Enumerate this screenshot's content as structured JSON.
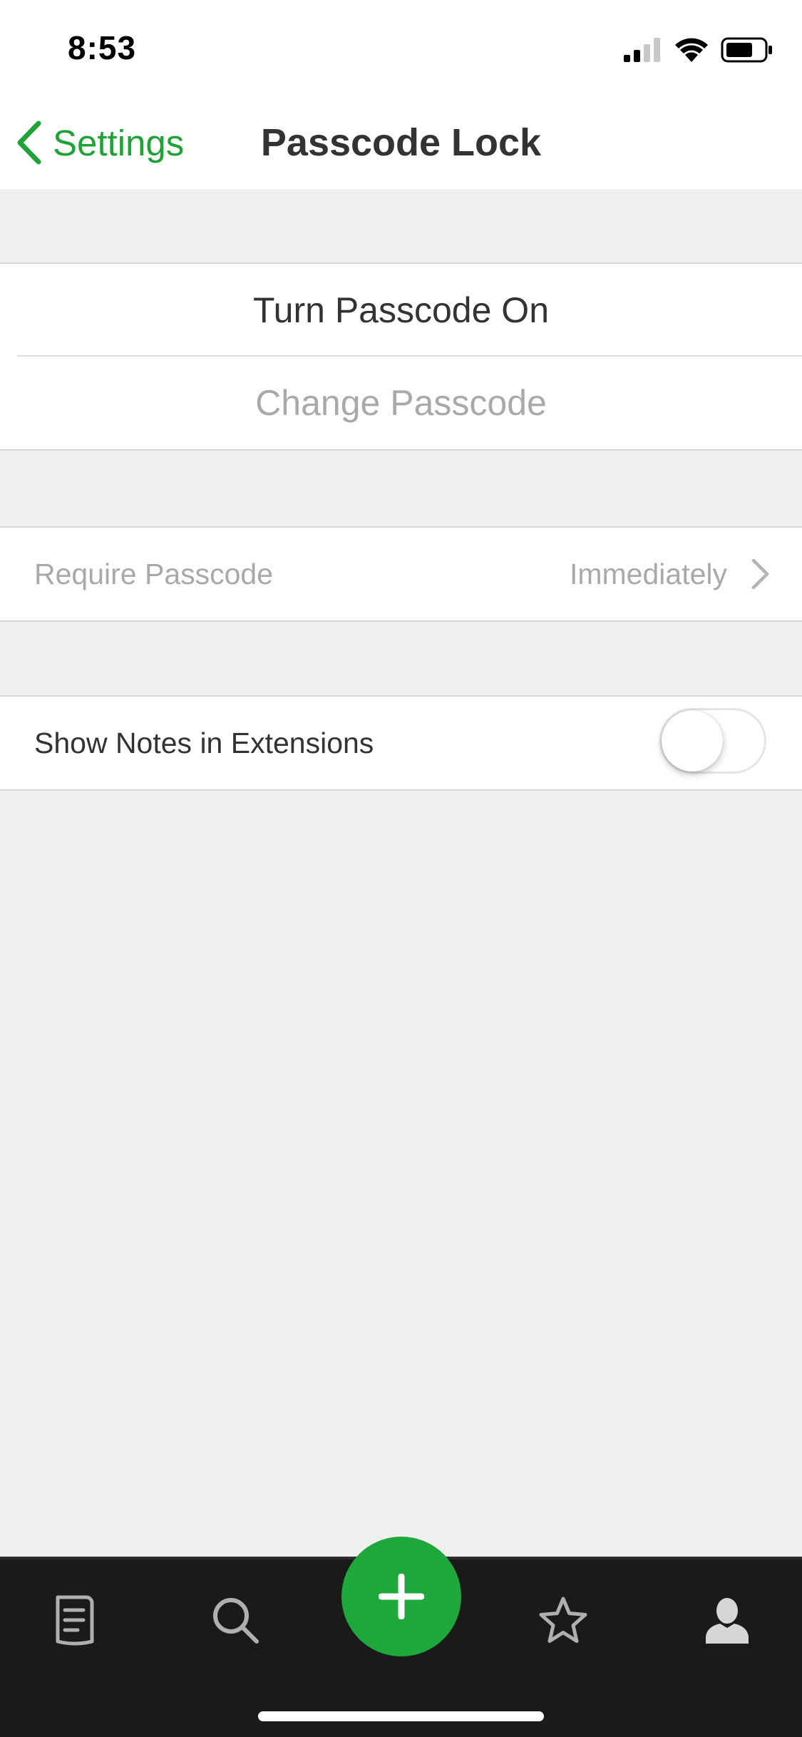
{
  "status_bar": {
    "time": "8:53",
    "icons": [
      "cellular-signal-icon",
      "wifi-icon",
      "battery-icon"
    ]
  },
  "nav": {
    "back_label": "Settings",
    "title": "Passcode Lock"
  },
  "passcode_group": {
    "turn_on_label": "Turn Passcode On",
    "change_label": "Change Passcode"
  },
  "require_group": {
    "label": "Require Passcode",
    "value": "Immediately"
  },
  "extensions_group": {
    "label": "Show Notes in Extensions",
    "toggle_on": false
  },
  "tab_bar": {
    "items": [
      "notes-icon",
      "search-icon",
      "add-icon",
      "star-icon",
      "account-icon"
    ]
  },
  "colors": {
    "accent": "#1EA73A",
    "disabled_text": "#A9A9A9",
    "tab_bar_bg": "#1A1A1A",
    "background": "#EEEFEF"
  }
}
